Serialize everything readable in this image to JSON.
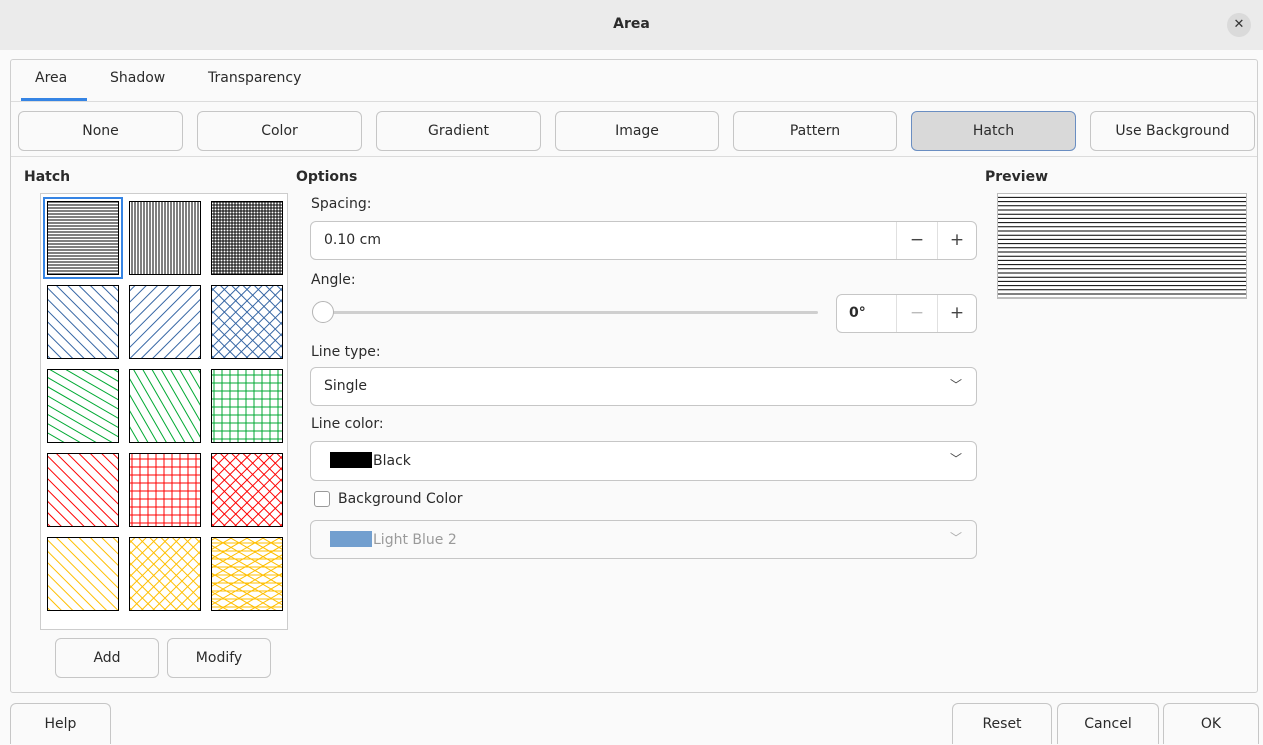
{
  "window": {
    "title": "Area",
    "close_icon": "close-icon"
  },
  "tabs": [
    {
      "label": "Area",
      "active": true
    },
    {
      "label": "Shadow",
      "active": false
    },
    {
      "label": "Transparency",
      "active": false
    }
  ],
  "fill_buttons": [
    {
      "label": "None"
    },
    {
      "label": "Color"
    },
    {
      "label": "Gradient"
    },
    {
      "label": "Image"
    },
    {
      "label": "Pattern"
    },
    {
      "label": "Hatch",
      "selected": true
    },
    {
      "label": "Use Background"
    }
  ],
  "hatch_panel": {
    "heading": "Hatch",
    "add_label": "Add",
    "modify_label": "Modify",
    "swatches": [
      {
        "name": "black-0",
        "color": "#000000",
        "angles": [
          0
        ],
        "selected": true
      },
      {
        "name": "black-90",
        "color": "#000000",
        "angles": [
          90
        ]
      },
      {
        "name": "black-crossed",
        "color": "#000000",
        "angles": [
          0,
          90
        ]
      },
      {
        "name": "blue-45",
        "color": "#3465a4",
        "angles": [
          45
        ]
      },
      {
        "name": "blue-minus-45",
        "color": "#3465a4",
        "angles": [
          -45
        ]
      },
      {
        "name": "blue-crossed-45",
        "color": "#3465a4",
        "angles": [
          45,
          -45
        ]
      },
      {
        "name": "green-30",
        "color": "#00a933",
        "angles": [
          30
        ]
      },
      {
        "name": "green-60",
        "color": "#00a933",
        "angles": [
          60
        ]
      },
      {
        "name": "green-crossed",
        "color": "#00a933",
        "angles": [
          0,
          90
        ]
      },
      {
        "name": "red-45",
        "color": "#ff0000",
        "angles": [
          45
        ]
      },
      {
        "name": "red-crossed",
        "color": "#ff0000",
        "angles": [
          0,
          90
        ]
      },
      {
        "name": "red-crossed-45",
        "color": "#ff0000",
        "angles": [
          45,
          -45
        ]
      },
      {
        "name": "yellow-45",
        "color": "#ffbf00",
        "angles": [
          45
        ]
      },
      {
        "name": "yellow-crossed-45",
        "color": "#ffbf00",
        "angles": [
          45,
          -45
        ]
      },
      {
        "name": "yellow-triple",
        "color": "#ffbf00",
        "angles": [
          0,
          30,
          -30
        ]
      }
    ]
  },
  "options": {
    "heading": "Options",
    "spacing_label": "Spacing:",
    "spacing_value": "0.10 cm",
    "angle_label": "Angle:",
    "angle_value": "0°",
    "line_type_label": "Line type:",
    "line_type_value": "Single",
    "line_color_label": "Line color:",
    "line_color_value": "Black",
    "line_color_hex": "#000000",
    "bg_color_label": "Background Color",
    "bg_color_checked": false,
    "bg_color_value": "Light Blue 2",
    "bg_color_hex": "#729fcf",
    "minus_glyph": "−",
    "plus_glyph": "+",
    "chevron_glyph": "﹀"
  },
  "preview": {
    "heading": "Preview",
    "line_color": "#000000",
    "angle": 0
  },
  "footer": {
    "help": "Help",
    "reset": "Reset",
    "cancel": "Cancel",
    "ok": "OK"
  }
}
